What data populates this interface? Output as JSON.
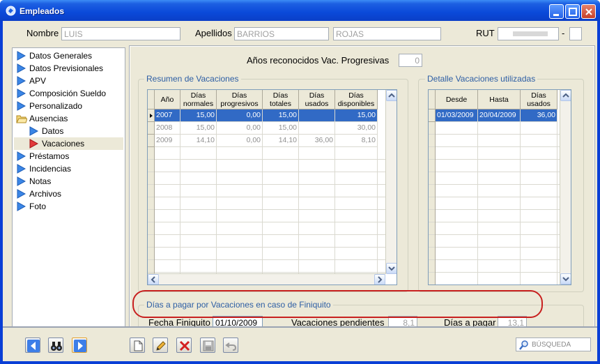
{
  "window": {
    "title": "Empleados"
  },
  "header": {
    "nombre_label": "Nombre",
    "nombre_value": "LUIS",
    "apellidos_label": "Apellidos",
    "apellido1_value": "BARRIOS",
    "apellido2_value": "ROJAS",
    "rut_label": "RUT",
    "rut_separator": "-"
  },
  "sidebar": {
    "items": [
      {
        "label": "Datos Generales",
        "icon": "arrow-right-icon"
      },
      {
        "label": "Datos Previsionales",
        "icon": "arrow-right-icon"
      },
      {
        "label": "APV",
        "icon": "arrow-right-icon"
      },
      {
        "label": "Composición Sueldo",
        "icon": "arrow-right-icon"
      },
      {
        "label": "Personalizado",
        "icon": "arrow-right-icon"
      },
      {
        "label": "Ausencias",
        "icon": "folder-open-icon"
      },
      {
        "label": "Datos",
        "icon": "arrow-right-icon"
      },
      {
        "label": "Vacaciones",
        "icon": "arrow-right-red-icon"
      },
      {
        "label": "Préstamos",
        "icon": "arrow-right-icon"
      },
      {
        "label": "Incidencias",
        "icon": "arrow-right-icon"
      },
      {
        "label": "Notas",
        "icon": "arrow-right-icon"
      },
      {
        "label": "Archivos",
        "icon": "arrow-right-icon"
      },
      {
        "label": "Foto",
        "icon": "arrow-right-icon"
      }
    ]
  },
  "main": {
    "anos_label": "Años reconocidos Vac. Progresivas",
    "anos_value": "0",
    "resumen": {
      "title": "Resumen de Vacaciones",
      "columns": [
        "Año",
        "Días normales",
        "Días progresivos",
        "Días totales",
        "Días usados",
        "Días disponibles"
      ],
      "rows": [
        [
          "2007",
          "15,00",
          "0,00",
          "15,00",
          "",
          "15,00"
        ],
        [
          "2008",
          "15,00",
          "0,00",
          "15,00",
          "",
          "30,00"
        ],
        [
          "2009",
          "14,10",
          "0,00",
          "14,10",
          "36,00",
          "8,10"
        ]
      ]
    },
    "detalle": {
      "title": "Detalle Vacaciones utilizadas",
      "columns": [
        "Desde",
        "Hasta",
        "Días usados"
      ],
      "rows": [
        [
          "01/03/2009",
          "20/04/2009",
          "36,00"
        ]
      ]
    },
    "finiquito": {
      "title": "Días a pagar por Vacaciones en caso de Finiquito",
      "fecha_label": "Fecha Finiquito",
      "fecha_value": "01/10/2009",
      "pendientes_label": "Vacaciones pendientes",
      "pendientes_value": "8,1",
      "dias_label": "Días a pagar",
      "dias_value": "13,1"
    }
  },
  "footer": {
    "search_placeholder": "BÚSQUEDA"
  },
  "colors": {
    "selection": "#316ac5",
    "accent_title": "#2d5ea4",
    "highlight": "#c8201f"
  }
}
